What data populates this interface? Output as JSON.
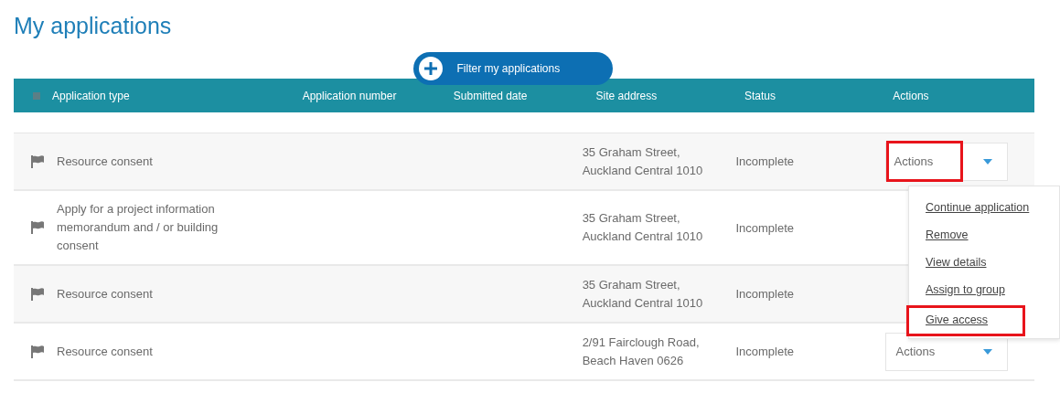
{
  "title": "My applications",
  "filter_button": {
    "label": "Filter my applications"
  },
  "table": {
    "columns": [
      "Application type",
      "Application number",
      "Submitted date",
      "Site address",
      "Status",
      "Actions"
    ],
    "rows": [
      {
        "application_type": "Resource consent",
        "site_address": "35 Graham Street, Auckland Central 1010",
        "status": "Incomplete",
        "action": {
          "label": "Actions",
          "highlighted": true
        }
      },
      {
        "application_type": "Apply for a project information memorandum and / or building consent",
        "site_address": "35 Graham Street, Auckland Central 1010",
        "status": "Incomplete"
      },
      {
        "application_type": "Resource consent",
        "site_address": "35 Graham Street, Auckland Central 1010",
        "status": "Incomplete"
      },
      {
        "application_type": "Resource consent",
        "site_address": "2/91 Fairclough Road, Beach Haven 0626",
        "status": "Incomplete",
        "action": {
          "label": "Actions",
          "highlighted": false
        }
      }
    ]
  },
  "actions_menu": {
    "items": [
      {
        "label": "Continue application",
        "highlighted": false
      },
      {
        "label": "Remove",
        "highlighted": false
      },
      {
        "label": "View details",
        "highlighted": false
      },
      {
        "label": "Assign to group",
        "highlighted": false
      },
      {
        "label": "Give access",
        "highlighted": true
      }
    ]
  }
}
